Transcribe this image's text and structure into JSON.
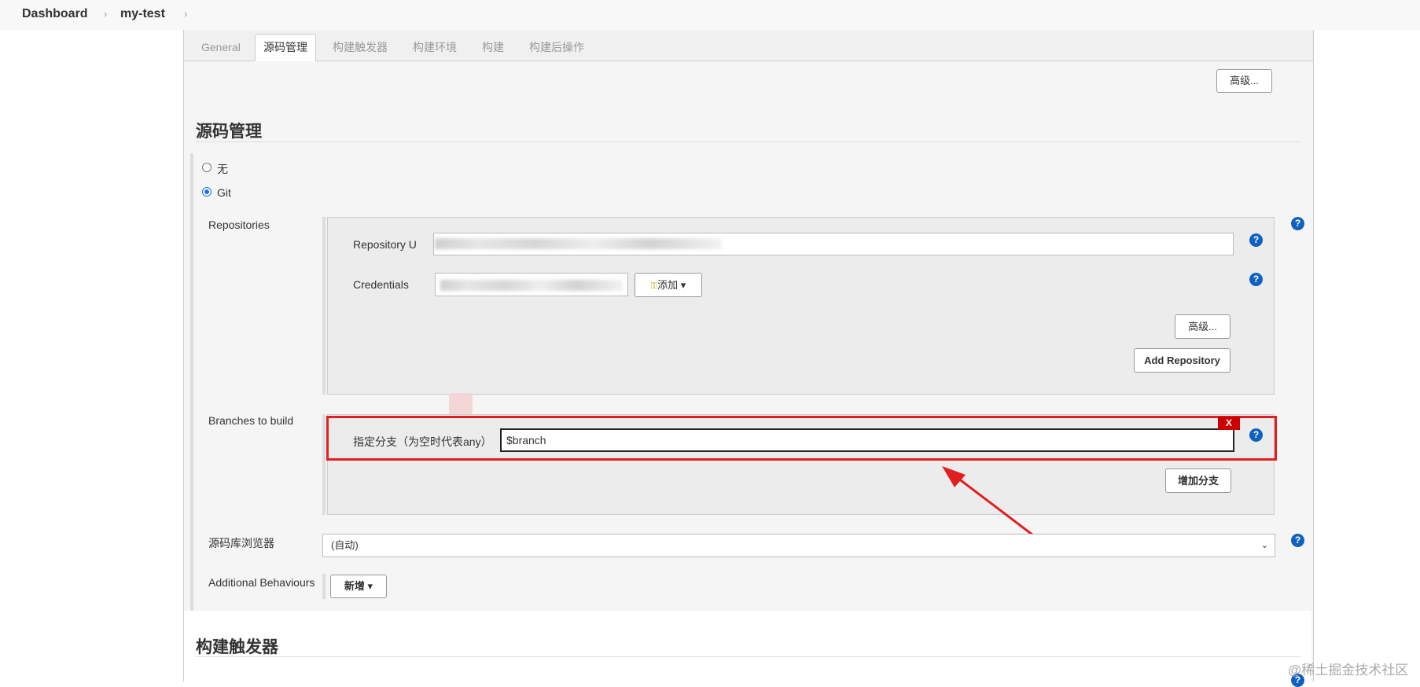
{
  "breadcrumb": {
    "dashboard": "Dashboard",
    "job": "my-test",
    "sep": "›"
  },
  "tabs": [
    "General",
    "源码管理",
    "构建触发器",
    "构建环境",
    "构建",
    "构建后操作"
  ],
  "top_advanced_button": "高级...",
  "scm": {
    "title": "源码管理",
    "radio_none": "无",
    "radio_git": "Git",
    "repositories_label": "Repositories",
    "repo_url_label": "Repository U",
    "credentials_label": "Credentials",
    "add_button": "添加",
    "advanced_button": "高级...",
    "add_repository_button": "Add Repository",
    "branches_label": "Branches to build",
    "branch_spec_label": "指定分支（为空时代表any）",
    "branch_spec_value": "$branch",
    "delete_button": "X",
    "add_branch_button": "增加分支",
    "browser_label": "源码库浏览器",
    "browser_value": "(自动)",
    "additional_behaviours_label": "Additional Behaviours",
    "new_button": "新增"
  },
  "triggers": {
    "title": "构建触发器"
  },
  "icons": {
    "help": "?",
    "caret": "▾",
    "key": "🔑"
  },
  "colors": {
    "accent": "#1060c0",
    "highlight": "#e02020",
    "delete": "#cc0000"
  },
  "watermark": "@稀土掘金技术社区"
}
